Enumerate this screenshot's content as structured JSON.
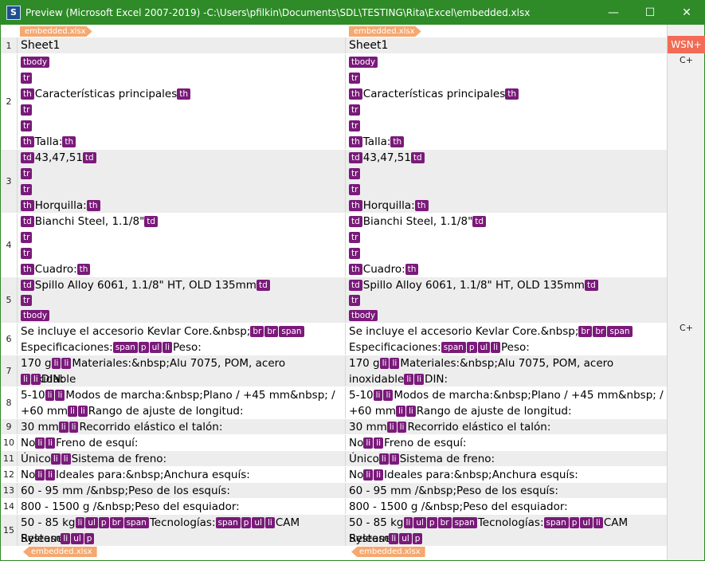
{
  "window": {
    "title": "Preview (Microsoft Excel 2007-2019) -C:\\Users\\pfilkin\\Documents\\SDL\\TESTING\\Rita\\Excel\\embedded.xlsx",
    "app_icon": "S",
    "minimize": "—",
    "maximize": "☐",
    "close": "✕"
  },
  "file_tag": "embedded.xlsx",
  "side": {
    "wsn": "WSN+",
    "cplus_1": "C+",
    "cplus_2": "C+"
  },
  "colors": {
    "titlebar": "#2e8b28",
    "tag_bg": "#7a1a7a",
    "file_tag": "#f5a870",
    "wsn": "#f26b55"
  },
  "rows": {
    "r1": {
      "num": "1",
      "left": "Sheet1",
      "right": "Sheet1"
    },
    "r2": {
      "num": "2",
      "l1": "tbody",
      "l2": "tr",
      "l3a": "th",
      "l3": "Características principales",
      "l3b": "th",
      "l4": "tr",
      "l5": "tr",
      "l6a": "th",
      "l6": "Talla:",
      "l6b": "th"
    },
    "r3": {
      "num": "3",
      "l1a": "td",
      "l1": "43,47,51",
      "l1b": "td",
      "l2": "tr",
      "l3": "tr",
      "l4a": "th",
      "l4": "Horquilla:",
      "l4b": "th"
    },
    "r4": {
      "num": "4",
      "l1a": "td",
      "l1": "Bianchi Steel, 1.1/8\"",
      "l1b": "td",
      "l2": "tr",
      "l3": "tr",
      "l4a": "th",
      "l4": "Cuadro:",
      "l4b": "th"
    },
    "r5": {
      "num": "5",
      "l1a": "td",
      "l1": "Spillo Alloy 6061, 1.1/8\" HT, OLD 135mm",
      "l1b": "td",
      "l2": "tr",
      "l3": "tbody"
    },
    "r6": {
      "num": "6",
      "a": "Se incluye el accesorio Kevlar Core.&nbsp;",
      "t1": "br",
      "t2": "br",
      "t3": "span",
      "b": "Especificaciones:",
      "t4": "span",
      "t5": "p",
      "t6": "ul",
      "t7": "li",
      "c": "Peso:"
    },
    "r7": {
      "num": "7",
      "a": "170 g",
      "t1": "li",
      "t2": "li",
      "b": "Materiales:&nbsp;Alu 7075, POM, acero inoxidable",
      "b_r1": "Materiales:&nbsp;Alu 7075, POM, acero",
      "b_r2": "inoxidable",
      "t3": "li",
      "t4": "li",
      "c": "DIN:"
    },
    "r8": {
      "num": "8",
      "a": "5-10",
      "t1": "li",
      "t2": "li",
      "b": "Modos de marcha:&nbsp;Plano / +45 mm&nbsp; /",
      "c": "+60 mm",
      "t3": "li",
      "t4": "li",
      "d": "Rango de ajuste de longitud:"
    },
    "r9": {
      "num": "9",
      "a": "30 mm",
      "t1": "li",
      "t2": "li",
      "b": "Recorrido elástico el talón:"
    },
    "r10": {
      "num": "10",
      "a": "No",
      "t1": "li",
      "t2": "li",
      "b": "Freno de esquí:"
    },
    "r11": {
      "num": "11",
      "a": "Único",
      "t1": "li",
      "t2": "li",
      "b": "Sistema de freno:"
    },
    "r12": {
      "num": "12",
      "a": "No",
      "t1": "li",
      "t2": "li",
      "b": "Ideales para:&nbsp;Anchura esquís:"
    },
    "r13": {
      "num": "13",
      "a": "60 - 95 mm /&nbsp;Peso de los esquís:"
    },
    "r14": {
      "num": "14",
      "a": "800 - 1500 g /&nbsp;Peso del esquiador:"
    },
    "r15": {
      "num": "15",
      "a": "50 - 85 kg",
      "t1": "li",
      "t2": "ul",
      "t3": "p",
      "t4": "br",
      "t5": "span",
      "b": "Tecnologías:",
      "t6": "span",
      "t7": "p",
      "t8": "ul",
      "t9": "li",
      "c": "CAM Release",
      "d": "System",
      "t10": "li",
      "t11": "ul",
      "t12": "p"
    }
  }
}
